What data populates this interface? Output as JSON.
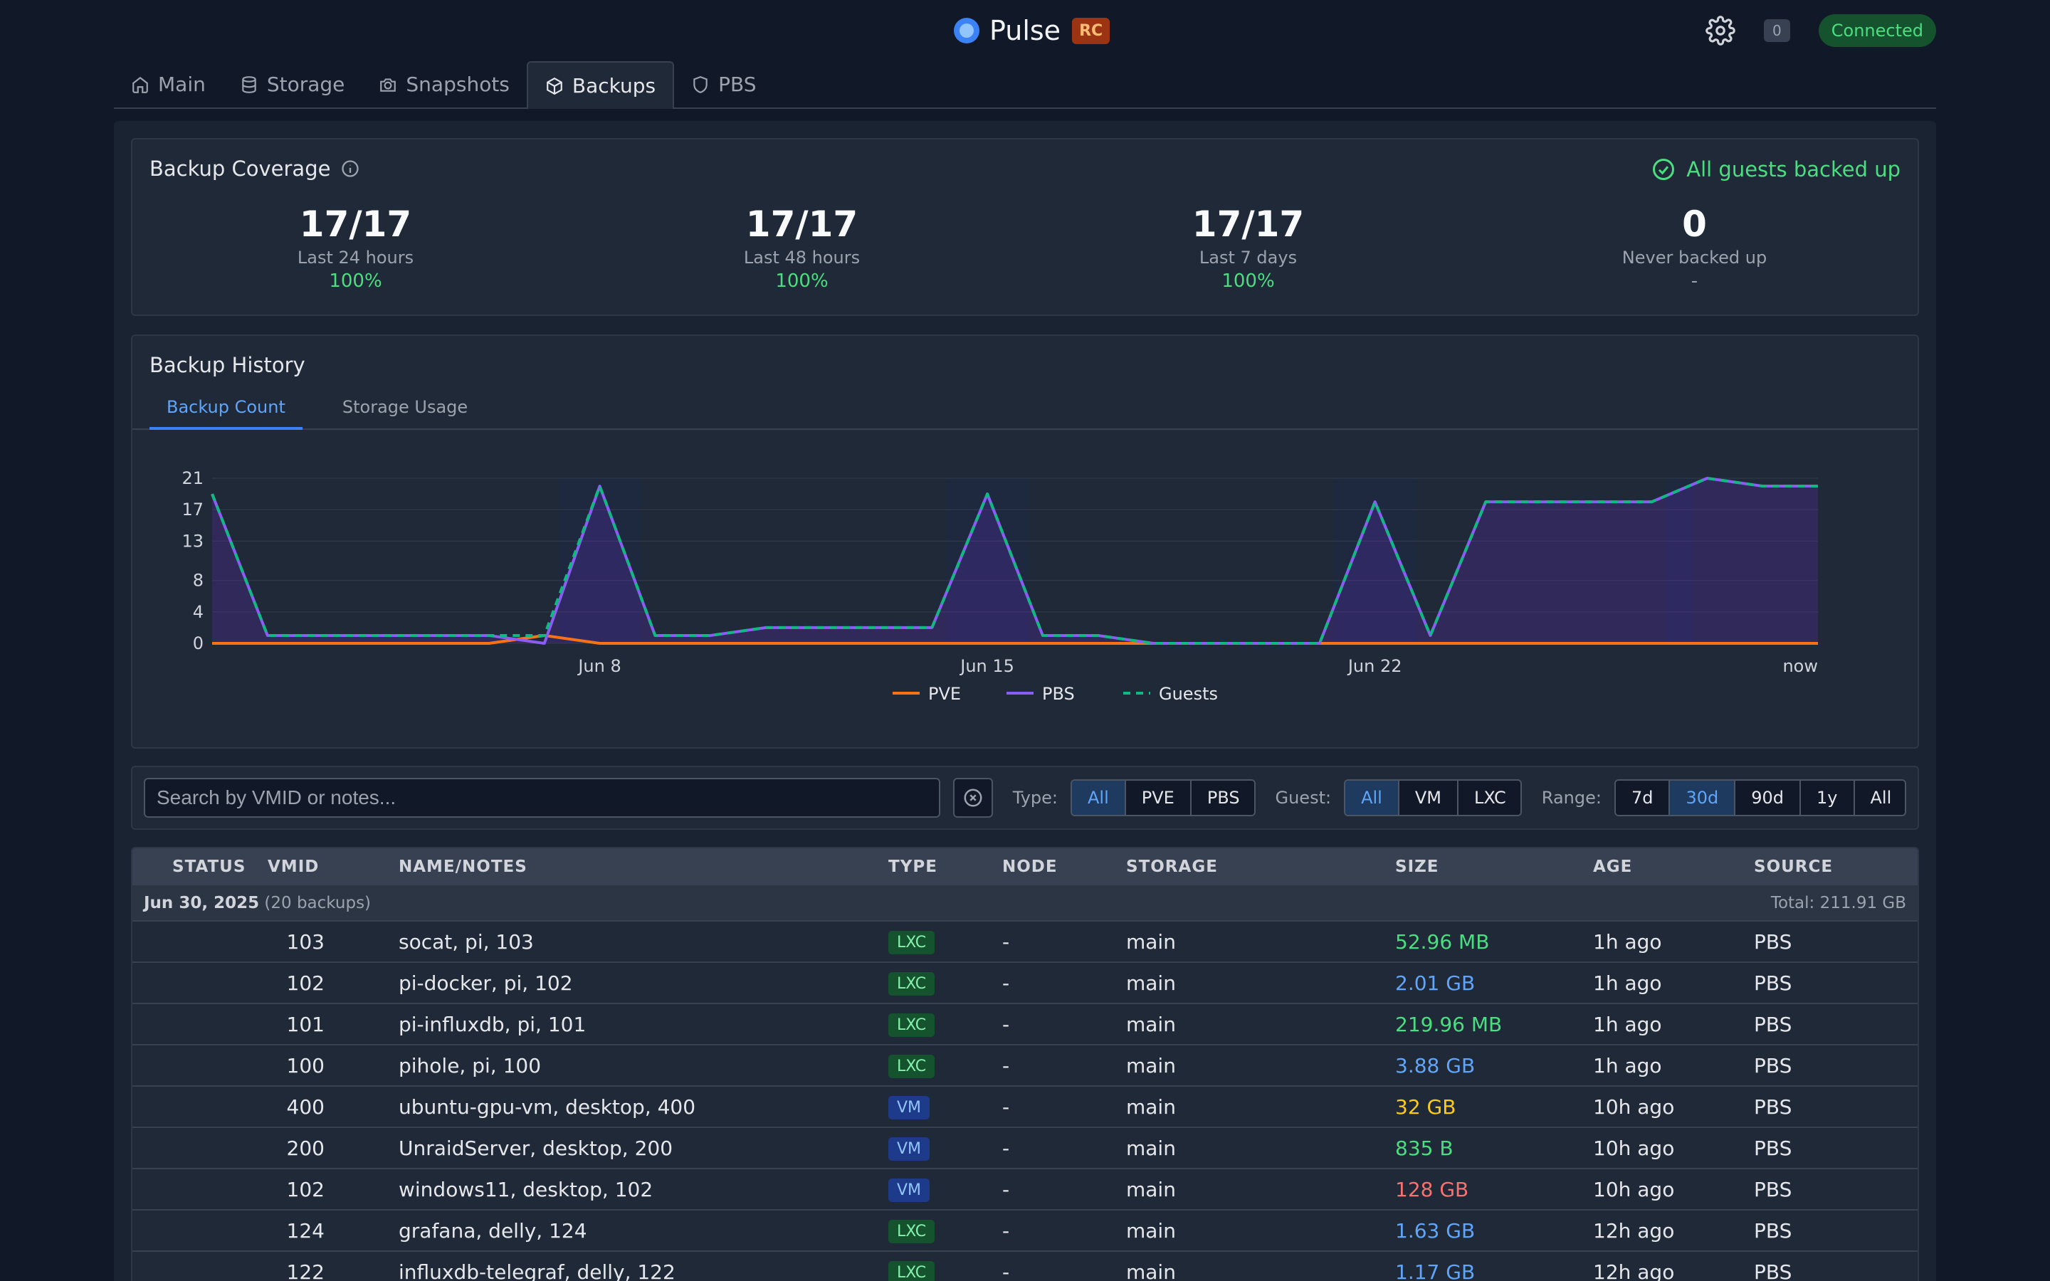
{
  "app": {
    "name": "Pulse",
    "badge": "RC",
    "notif_count": "0",
    "status": "Connected"
  },
  "tabs": [
    {
      "label": "Main"
    },
    {
      "label": "Storage"
    },
    {
      "label": "Snapshots"
    },
    {
      "label": "Backups"
    },
    {
      "label": "PBS"
    }
  ],
  "coverage": {
    "title": "Backup Coverage",
    "status": "All guests backed up",
    "stats": [
      {
        "value": "17/17",
        "label": "Last 24 hours",
        "pct": "100%"
      },
      {
        "value": "17/17",
        "label": "Last 48 hours",
        "pct": "100%"
      },
      {
        "value": "17/17",
        "label": "Last 7 days",
        "pct": "100%"
      },
      {
        "value": "0",
        "label": "Never backed up",
        "pct": "-"
      }
    ]
  },
  "history": {
    "title": "Backup History",
    "tabs": [
      "Backup Count",
      "Storage Usage"
    ]
  },
  "chart_data": {
    "type": "line",
    "y_ticks": [
      "0",
      "4",
      "8",
      "13",
      "17",
      "21"
    ],
    "ylim": [
      0,
      21
    ],
    "x_ticks": [
      {
        "label": "Jun 8",
        "day": 7
      },
      {
        "label": "Jun 15",
        "day": 14
      },
      {
        "label": "Jun 22",
        "day": 21
      },
      {
        "label": "now",
        "day": 29
      }
    ],
    "grid": true,
    "legend": "bottom",
    "colors": {
      "PVE": "#f97316",
      "PBS": "#8b5cf6",
      "Guests": "#10b981"
    },
    "series": [
      {
        "name": "PVE",
        "values": [
          0,
          0,
          0,
          0,
          0,
          0,
          1,
          0,
          0,
          0,
          0,
          0,
          0,
          0,
          0,
          0,
          0,
          0,
          0,
          0,
          0,
          0,
          0,
          0,
          0,
          0,
          0,
          0,
          0,
          0
        ]
      },
      {
        "name": "PBS",
        "values": [
          19,
          1,
          1,
          1,
          1,
          1,
          0,
          20,
          1,
          1,
          2,
          2,
          2,
          2,
          19,
          1,
          1,
          0,
          0,
          0,
          0,
          18,
          1,
          18,
          18,
          18,
          18,
          21,
          20,
          20
        ]
      },
      {
        "name": "Guests",
        "values": [
          19,
          1,
          1,
          1,
          1,
          1,
          1,
          20,
          1,
          1,
          2,
          2,
          2,
          2,
          19,
          1,
          1,
          0,
          0,
          0,
          0,
          18,
          1,
          18,
          18,
          18,
          18,
          21,
          20,
          20
        ]
      }
    ]
  },
  "filters": {
    "search_placeholder": "Search by VMID or notes...",
    "type_label": "Type:",
    "type_options": [
      "All",
      "PVE",
      "PBS"
    ],
    "guest_label": "Guest:",
    "guest_options": [
      "All",
      "VM",
      "LXC"
    ],
    "range_label": "Range:",
    "range_options": [
      "7d",
      "30d",
      "90d",
      "1y",
      "All"
    ]
  },
  "table": {
    "headers": [
      "STATUS",
      "VMID",
      "NAME/NOTES",
      "TYPE",
      "NODE",
      "STORAGE",
      "SIZE",
      "AGE",
      "SOURCE"
    ],
    "group": {
      "date": "Jun 30, 2025",
      "count": "(20 backups)",
      "total": "Total: 211.91 GB"
    },
    "rows": [
      {
        "vmid": "103",
        "name": "socat, pi, 103",
        "type": "LXC",
        "node": "-",
        "storage": "main",
        "size": "52.96 MB",
        "size_color": "#4ade80",
        "age": "1h ago",
        "source": "PBS"
      },
      {
        "vmid": "102",
        "name": "pi-docker, pi, 102",
        "type": "LXC",
        "node": "-",
        "storage": "main",
        "size": "2.01 GB",
        "size_color": "#60a5fa",
        "age": "1h ago",
        "source": "PBS"
      },
      {
        "vmid": "101",
        "name": "pi-influxdb, pi, 101",
        "type": "LXC",
        "node": "-",
        "storage": "main",
        "size": "219.96 MB",
        "size_color": "#4ade80",
        "age": "1h ago",
        "source": "PBS"
      },
      {
        "vmid": "100",
        "name": "pihole, pi, 100",
        "type": "LXC",
        "node": "-",
        "storage": "main",
        "size": "3.88 GB",
        "size_color": "#60a5fa",
        "age": "1h ago",
        "source": "PBS"
      },
      {
        "vmid": "400",
        "name": "ubuntu-gpu-vm, desktop, 400",
        "type": "VM",
        "node": "-",
        "storage": "main",
        "size": "32 GB",
        "size_color": "#facc15",
        "age": "10h ago",
        "source": "PBS"
      },
      {
        "vmid": "200",
        "name": "UnraidServer, desktop, 200",
        "type": "VM",
        "node": "-",
        "storage": "main",
        "size": "835 B",
        "size_color": "#4ade80",
        "age": "10h ago",
        "source": "PBS"
      },
      {
        "vmid": "102",
        "name": "windows11, desktop, 102",
        "type": "VM",
        "node": "-",
        "storage": "main",
        "size": "128 GB",
        "size_color": "#f87171",
        "age": "10h ago",
        "source": "PBS"
      },
      {
        "vmid": "124",
        "name": "grafana, delly, 124",
        "type": "LXC",
        "node": "-",
        "storage": "main",
        "size": "1.63 GB",
        "size_color": "#60a5fa",
        "age": "12h ago",
        "source": "PBS"
      },
      {
        "vmid": "122",
        "name": "influxdb-telegraf, delly, 122",
        "type": "LXC",
        "node": "-",
        "storage": "main",
        "size": "1.17 GB",
        "size_color": "#60a5fa",
        "age": "12h ago",
        "source": "PBS"
      }
    ]
  }
}
